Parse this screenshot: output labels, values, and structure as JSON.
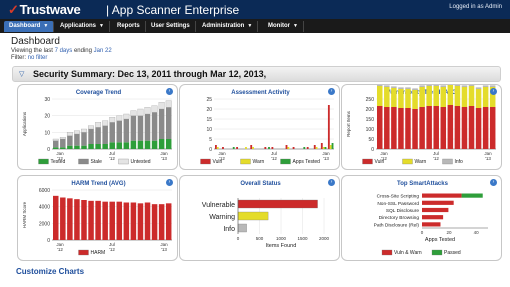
{
  "header": {
    "brand": "Trustwave",
    "app_name": "| App Scanner Enterprise",
    "logged_in": "Logged in as Admin"
  },
  "nav": {
    "items": [
      {
        "label": "Dashboard",
        "caret": true,
        "active": true
      },
      {
        "label": "Applications",
        "caret": true,
        "active": false
      },
      {
        "label": "Reports",
        "caret": false,
        "active": false
      },
      {
        "label": "User Settings",
        "caret": false,
        "active": false
      },
      {
        "label": "Administration",
        "caret": true,
        "active": false
      },
      {
        "label": "Monitor",
        "caret": true,
        "active": false
      }
    ]
  },
  "page": {
    "title": "Dashboard",
    "viewing_prefix": "Viewing the last",
    "viewing_days": "7 days",
    "viewing_ending": "ending",
    "viewing_date": "Jan 22",
    "filter_label": "Filter:",
    "filter_value": "no filter",
    "summary": "Security Summary: Dec 13, 2011 through Mar 12, 2013,",
    "customize": "Customize Charts"
  },
  "colors": {
    "tested": "#2e9e3a",
    "stale": "#8a8a8a",
    "untested": "#e4e4e4",
    "vuln": "#cc2b2b",
    "warn": "#e4dc2a",
    "info": "#b8b8b8",
    "nav_active": "#3b6fb6",
    "header_bg": "#0b2a56",
    "title_blue": "#1e4e9c"
  },
  "chart_data": [
    {
      "type": "bar",
      "title": "Coverage Trend",
      "ylabel": "Applications",
      "yticks": [
        "30",
        "20",
        "10",
        "0"
      ],
      "xticks": [
        "Jan\n'12",
        "Jul\n'12",
        "Jan\n'13"
      ],
      "series": [
        {
          "name": "Tested",
          "color": "#2e9e3a",
          "values": [
            1,
            1,
            2,
            2,
            2,
            3,
            3,
            3,
            4,
            4,
            4,
            5,
            5,
            5,
            5,
            6,
            6
          ]
        },
        {
          "name": "Stale",
          "color": "#8a8a8a",
          "values": [
            4,
            5,
            6,
            7,
            8,
            9,
            10,
            11,
            12,
            13,
            14,
            15,
            15,
            16,
            17,
            18,
            19
          ]
        },
        {
          "name": "Untested",
          "color": "#e4e4e4",
          "values": [
            1,
            1,
            2,
            2,
            2,
            2,
            3,
            3,
            3,
            3,
            3,
            3,
            4,
            4,
            4,
            4,
            4
          ]
        }
      ],
      "ylim": [
        0,
        30
      ]
    },
    {
      "type": "bar",
      "title": "Assessment Activity",
      "yticks": [
        "25",
        "20",
        "15",
        "10",
        "5",
        "0"
      ],
      "xticks": [
        "Jan\n'12",
        "Jul\n'12",
        "Jan\n'13"
      ],
      "series": [
        {
          "name": "Vuln",
          "color": "#cc2b2b",
          "values": [
            2,
            1,
            0,
            1,
            0,
            2,
            0,
            1,
            1,
            0,
            2,
            1,
            0,
            1,
            2,
            3,
            22
          ]
        },
        {
          "name": "Warn",
          "color": "#e4dc2a",
          "values": [
            1,
            0,
            0,
            0,
            1,
            1,
            0,
            0,
            0,
            0,
            1,
            0,
            0,
            0,
            1,
            1,
            2
          ]
        },
        {
          "name": "Apps Tested",
          "color": "#2e9e3a",
          "values": [
            0,
            0,
            1,
            0,
            0,
            0,
            0,
            1,
            0,
            0,
            0,
            0,
            1,
            0,
            0,
            1,
            3
          ]
        }
      ],
      "ylim": [
        0,
        25
      ]
    },
    {
      "type": "bar",
      "title": "Vulnerability Trend (AVG)",
      "ylabel": "Report Items",
      "yticks": [
        "250",
        "200",
        "150",
        "100",
        "50",
        "0"
      ],
      "xticks": [
        "Jan\n'12",
        "Jul\n'12",
        "Jan\n'13"
      ],
      "series": [
        {
          "name": "Vuln",
          "color": "#cc2b2b",
          "values": [
            215,
            210,
            210,
            205,
            205,
            200,
            210,
            215,
            215,
            210,
            220,
            215,
            210,
            215,
            205,
            210,
            210
          ]
        },
        {
          "name": "Warn",
          "color": "#e4dc2a",
          "values": [
            100,
            100,
            95,
            95,
            95,
            95,
            100,
            100,
            100,
            100,
            105,
            100,
            100,
            100,
            95,
            100,
            100
          ]
        },
        {
          "name": "Info",
          "color": "#b8b8b8",
          "values": [
            8,
            8,
            8,
            8,
            8,
            8,
            8,
            8,
            8,
            8,
            8,
            8,
            8,
            8,
            8,
            8,
            8
          ]
        }
      ],
      "ylim": [
        0,
        250
      ]
    },
    {
      "type": "bar",
      "title": "HARM Trend (AVG)",
      "ylabel": "HARM Score",
      "yticks": [
        "6000",
        "4000",
        "2000",
        "0"
      ],
      "xticks": [
        "Jan\n'12",
        "Jul\n'12",
        "Jan\n'13"
      ],
      "series": [
        {
          "name": "HARM",
          "color": "#cc2b2b",
          "values": [
            5300,
            5100,
            5000,
            4900,
            4800,
            4700,
            4700,
            4600,
            4600,
            4600,
            4500,
            4500,
            4400,
            4500,
            4300,
            4300,
            4400
          ]
        }
      ],
      "ylim": [
        0,
        6000
      ]
    },
    {
      "type": "bar",
      "orientation": "horizontal",
      "title": "Overall Status",
      "xlabel": "Items Found",
      "categories": [
        "Vulnerable",
        "Warning",
        "Info"
      ],
      "values": [
        1850,
        700,
        200
      ],
      "colors": [
        "#cc2b2b",
        "#e4dc2a",
        "#b8b8b8"
      ],
      "xticks": [
        "0",
        "500",
        "1000",
        "1500",
        "2000"
      ],
      "xlim": [
        0,
        2000
      ]
    },
    {
      "type": "bar",
      "orientation": "horizontal",
      "title": "Top SmartAttacks",
      "xlabel": "Apps Tested",
      "categories": [
        "Cross-Site Scripting",
        "Non-SSL Password",
        "SQL Disclosure",
        "Directory Browsing",
        "Path Disclosure (Rel)"
      ],
      "series": [
        {
          "name": "Vuln & Warn",
          "color": "#cc2b2b",
          "values": [
            30,
            24,
            20,
            16,
            14
          ]
        },
        {
          "name": "Passed",
          "color": "#2e9e3a",
          "values": [
            16,
            0,
            0,
            0,
            0
          ]
        }
      ],
      "xticks": [
        "0",
        "20",
        "40"
      ],
      "xlim": [
        0,
        50
      ]
    }
  ]
}
